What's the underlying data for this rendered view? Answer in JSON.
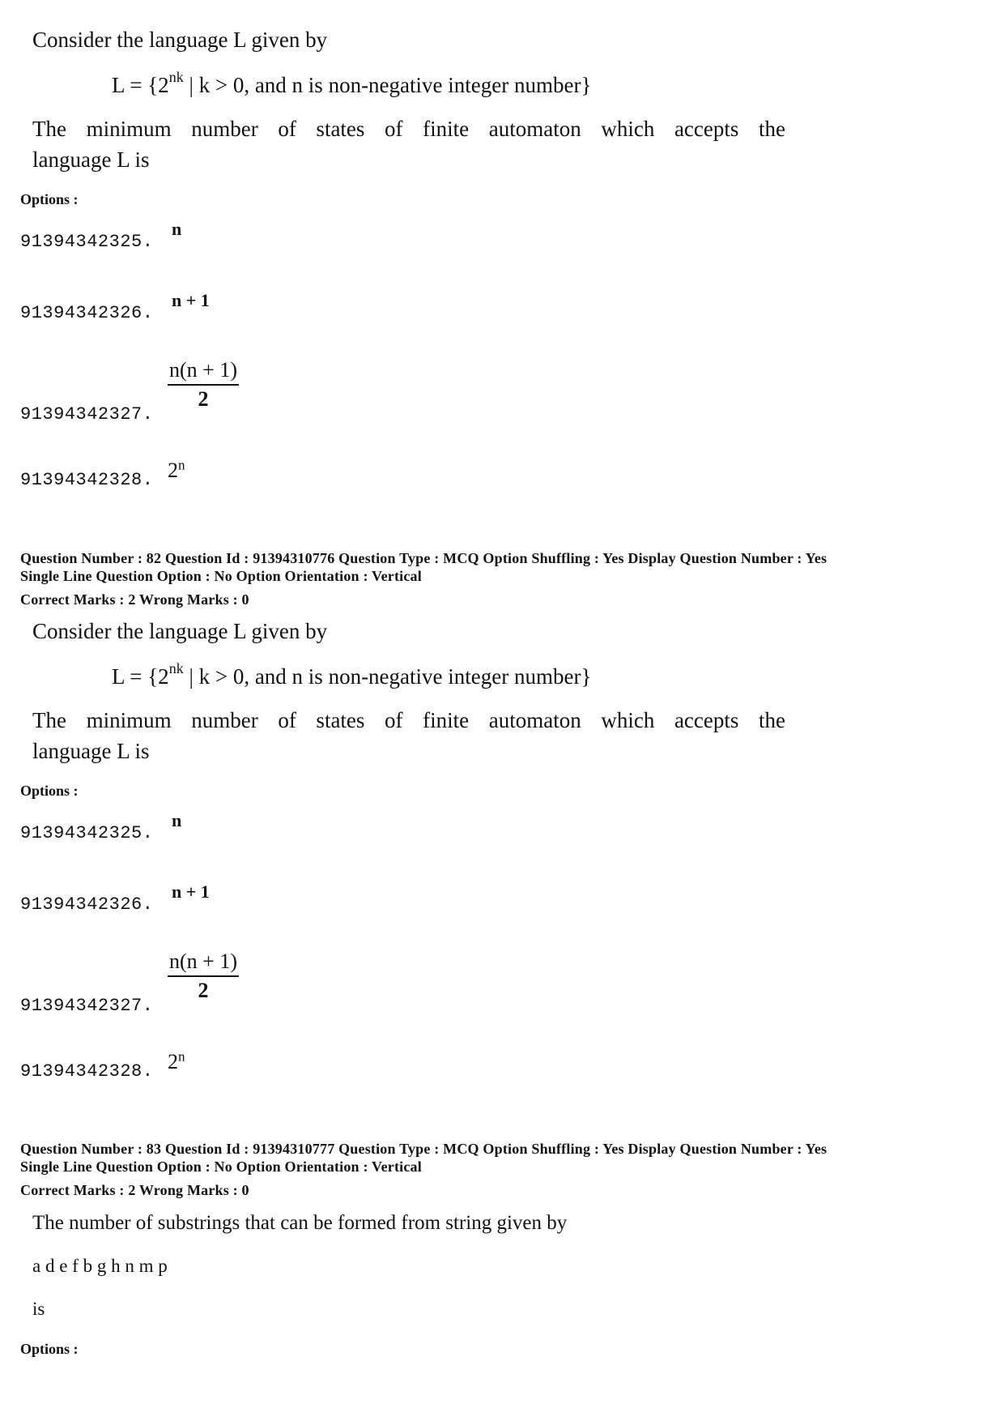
{
  "questions": [
    {
      "meta": null,
      "stem_line1": "Consider the language L given by",
      "formula_prefix": "L = {2",
      "formula_sup": "nk",
      "formula_suffix": " | k > 0, and n is non-negative integer number}",
      "stem_line2": "The minimum number of states of finite automaton which accepts the",
      "stem_line3": "language L is",
      "options_label": "Options :",
      "options": [
        {
          "id": "91394342325.",
          "value": "n"
        },
        {
          "id": "91394342326.",
          "value": "n + 1"
        },
        {
          "id": "91394342327.",
          "numerator": "n(n + 1)",
          "denominator": "2"
        },
        {
          "id": "91394342328.",
          "base": "2",
          "sup": "n"
        }
      ]
    },
    {
      "meta_line1": "Question Number : 82  Question Id : 91394310776  Question Type : MCQ  Option Shuffling : Yes  Display Question Number : Yes",
      "meta_line2": "Single Line Question Option : No  Option Orientation : Vertical",
      "marks": "Correct Marks : 2  Wrong Marks : 0",
      "stem_line1": "Consider the language L given by",
      "formula_prefix": "L = {2",
      "formula_sup": "nk",
      "formula_suffix": " | k > 0, and n is non-negative integer number}",
      "stem_line2": "The minimum number of states of finite automaton which accepts the",
      "stem_line3": "language L is",
      "options_label": "Options :",
      "options": [
        {
          "id": "91394342325.",
          "value": "n"
        },
        {
          "id": "91394342326.",
          "value": "n + 1"
        },
        {
          "id": "91394342327.",
          "numerator": "n(n + 1)",
          "denominator": "2"
        },
        {
          "id": "91394342328.",
          "base": "2",
          "sup": "n"
        }
      ]
    },
    {
      "meta_line1": "Question Number : 83  Question Id : 91394310777  Question Type : MCQ  Option Shuffling : Yes  Display Question Number : Yes",
      "meta_line2": "Single Line Question Option : No  Option Orientation : Vertical",
      "marks": "Correct Marks : 2  Wrong Marks : 0",
      "stem_line1": "The number of substrings that can be formed from string given by",
      "string_value": "a d e f b g h n m p",
      "stem_line3": "is",
      "options_label": "Options :"
    }
  ]
}
